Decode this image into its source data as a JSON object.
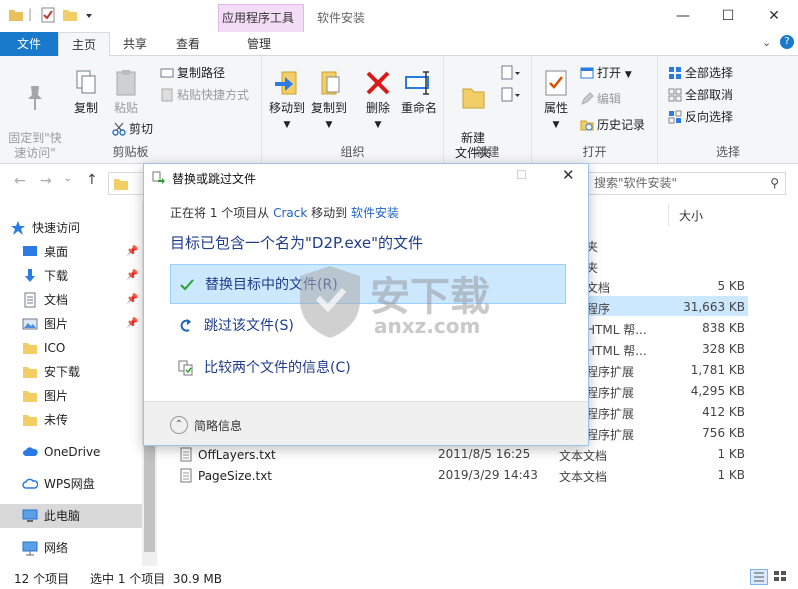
{
  "window": {
    "context_tab_group": "应用程序工具",
    "title": "软件安装"
  },
  "tabs": [
    {
      "label": "文件"
    },
    {
      "label": "主页"
    },
    {
      "label": "共享"
    },
    {
      "label": "查看"
    },
    {
      "label": "管理"
    }
  ],
  "ribbon": {
    "clipboard": {
      "group_label": "剪贴板",
      "pin": "固定到\"快\n速访问\"",
      "copy": "复制",
      "paste": "粘贴",
      "copy_path": "复制路径",
      "paste_shortcut": "粘贴快捷方式",
      "cut": "剪切"
    },
    "organize": {
      "group_label": "组织",
      "move_to": "移动到",
      "copy_to": "复制到",
      "delete": "删除",
      "rename": "重命名"
    },
    "new": {
      "group_label": "新建",
      "new_folder": "新建\n文件夹"
    },
    "open": {
      "group_label": "打开",
      "properties": "属性",
      "open": "打开",
      "edit": "编辑",
      "history": "历史记录"
    },
    "select": {
      "group_label": "选择",
      "select_all": "全部选择",
      "select_none": "全部取消",
      "invert": "反向选择"
    }
  },
  "search": {
    "placeholder": "搜索\"软件安装\""
  },
  "nav": {
    "quick_access": "快速访问",
    "items": [
      {
        "label": "桌面"
      },
      {
        "label": "下载"
      },
      {
        "label": "文档"
      },
      {
        "label": "图片"
      },
      {
        "label": "ICO"
      },
      {
        "label": "安下载"
      },
      {
        "label": "图片"
      },
      {
        "label": "未传"
      }
    ],
    "onedrive": "OneDrive",
    "wps": "WPS网盘",
    "this_pc": "此电脑",
    "network": "网络"
  },
  "filelist": {
    "col_size": "大小",
    "partial_rows": [
      {
        "type": "夹",
        "size": ""
      },
      {
        "type": "夹",
        "size": ""
      },
      {
        "type": "文档",
        "size": "5 KB"
      },
      {
        "type": "程序",
        "size": "31,663 KB"
      },
      {
        "type": "HTML 帮...",
        "size": "838 KB"
      },
      {
        "type": "HTML 帮...",
        "size": "328 KB"
      },
      {
        "type": "程序扩展",
        "size": "1,781 KB"
      },
      {
        "type": "程序扩展",
        "size": "4,295 KB"
      },
      {
        "type": "程序扩展",
        "size": "412 KB"
      },
      {
        "type": "程序扩展",
        "size": "756 KB"
      }
    ],
    "rows": [
      {
        "name": "OffLayers.txt",
        "date": "2011/8/5 16:25",
        "type": "文本文档",
        "size": "1 KB"
      },
      {
        "name": "PageSize.txt",
        "date": "2019/3/29 14:43",
        "type": "文本文档",
        "size": "1 KB"
      }
    ]
  },
  "status": {
    "count": "12 个项目",
    "selected": "选中 1 个项目  30.9 MB"
  },
  "dialog": {
    "title": "替换或跳过文件",
    "from_prefix": "正在将 1 个项目从",
    "source": "Crack",
    "move_to": "移动到",
    "dest": "软件安装",
    "message": "目标已包含一个名为\"D2P.exe\"的文件",
    "options": [
      {
        "label": "替换目标中的文件(R)"
      },
      {
        "label": "跳过该文件(S)"
      },
      {
        "label": "比较两个文件的信息(C)"
      }
    ],
    "more_info": "简略信息"
  },
  "watermark": {
    "text": "安下载",
    "domain": "anxz.com"
  },
  "colors": {
    "accent": "#1979ca",
    "link": "#1e62c2",
    "selected": "#cce8ff",
    "context": "#f3dcf6"
  }
}
